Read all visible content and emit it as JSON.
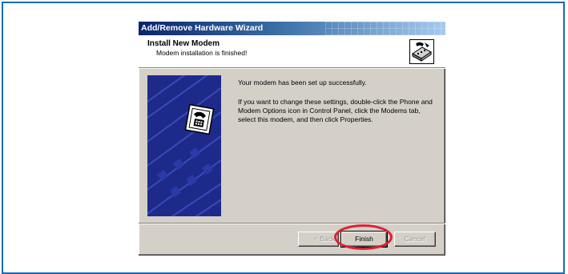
{
  "window": {
    "title": "Add/Remove Hardware Wizard"
  },
  "header": {
    "title": "Install New Modem",
    "subtitle": "Modem installation is finished!",
    "icon": "modem-wizard-icon"
  },
  "side_panel": {
    "icon": "telephone-icon"
  },
  "body": {
    "success_message": "Your modem has been set up successfully.",
    "instructions": "If you want to change these settings, double-click the Phone and Modem Options icon in Control Panel, click the Modems tab, select this modem, and then click Properties."
  },
  "buttons": {
    "back": "< Back",
    "finish": "Finish",
    "cancel": "Cancel"
  },
  "colors": {
    "titlebar_start": "#0a246a",
    "titlebar_end": "#a6caf0",
    "dialog_face": "#d4d0c8",
    "highlight_ring": "#e02030",
    "page_border": "#1b6ab5"
  }
}
